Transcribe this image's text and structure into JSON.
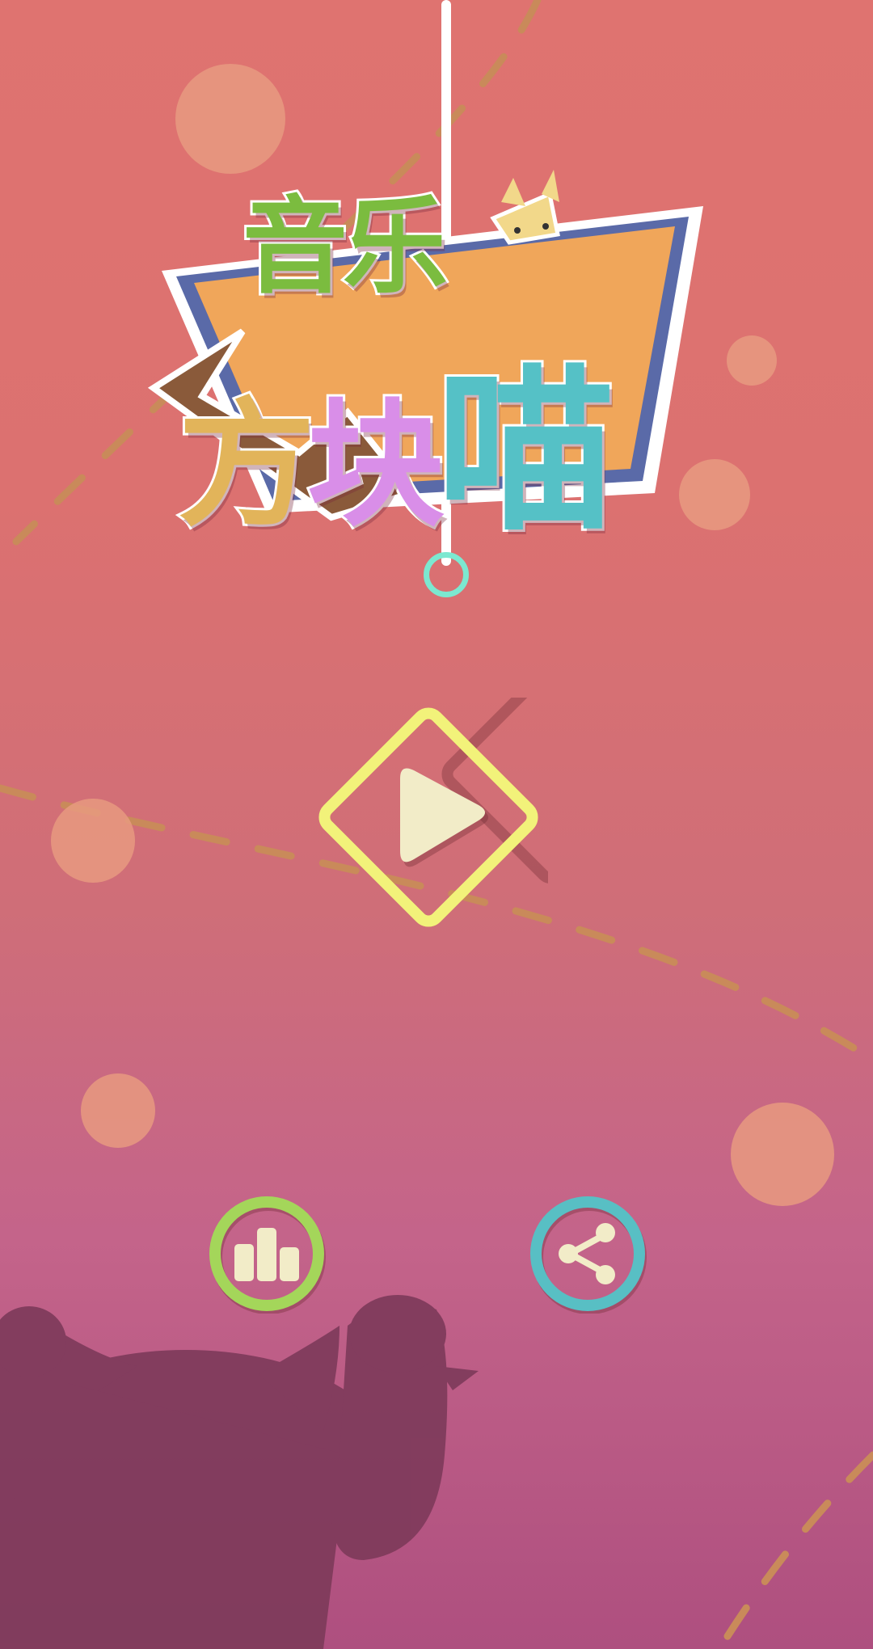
{
  "game": {
    "title_line1": "音乐",
    "title_line2_part1": "方",
    "title_line2_part2": "块",
    "title_line2_part3": "喵"
  },
  "buttons": {
    "play": {
      "icon": "play-icon",
      "color": "#f2f27a",
      "icon_color": "#f2ecc8"
    },
    "rank": {
      "icon": "bar-chart-icon",
      "color": "#a4d65a",
      "icon_color": "#f2ecc8"
    },
    "share": {
      "icon": "share-icon",
      "color": "#58bfc4",
      "icon_color": "#f2ecc8"
    }
  },
  "colors": {
    "bg_top": "#df7370",
    "bg_bottom": "#ae4f7f",
    "dash_line": "#c98a5a",
    "bubble": "#e89a80",
    "cat_silhouette": "#7d3a5a"
  }
}
